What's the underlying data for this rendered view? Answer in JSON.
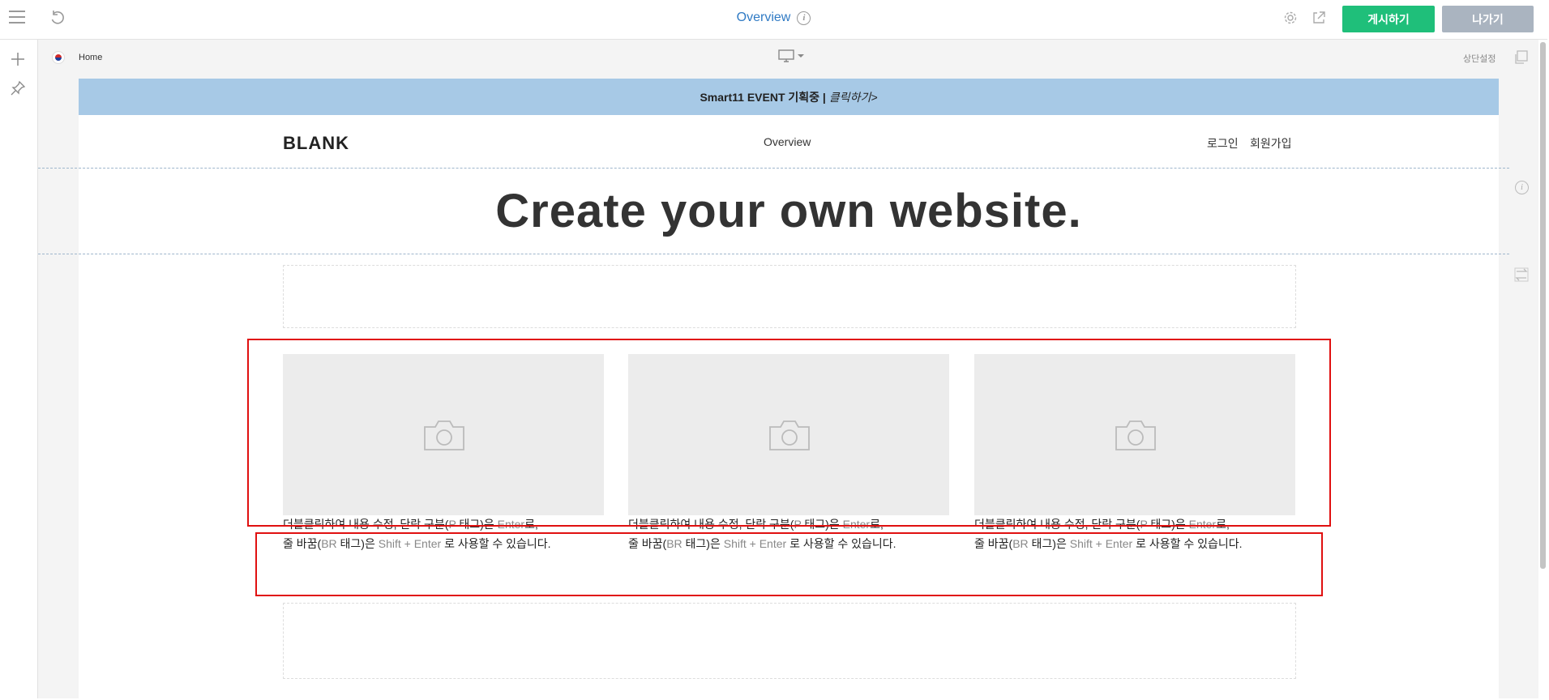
{
  "topbar": {
    "title": "Overview",
    "publish_label": "게시하기",
    "exit_label": "나가기",
    "icons": [
      "menu-icon",
      "undo-icon",
      "info-icon",
      "gear-icon",
      "external-link-icon"
    ]
  },
  "leftbar": {
    "icons": [
      "plus-icon",
      "pin-icon"
    ]
  },
  "canvas": {
    "home_label": "Home",
    "language_flag": "korea-flag-icon",
    "device": "desktop",
    "top_settings_label": "상단설정"
  },
  "page": {
    "banner": {
      "bold": "Smart11 EVENT 기획중 |",
      "italic": "클릭하기>",
      "color": "#a7c9e6"
    },
    "brand": "BLANK",
    "nav": {
      "overview": "Overview",
      "login": "로그인",
      "signup": "회원가입"
    },
    "hero_title": "Create your own website.",
    "captions": [
      {
        "line1_a": "더블클릭하여 내용 수정, 단락 구분(",
        "line1_b": "P",
        "line1_c": " 태그)은 ",
        "line1_d": "Enter",
        "line1_e": "로,",
        "line2_a": "줄 바꿈(",
        "line2_b": "BR",
        "line2_c": " 태그)은 ",
        "line2_d": "Shift + Enter",
        "line2_e": " 로 사용할 수 있습니다."
      },
      {
        "line1_a": "더블클릭하여 내용 수정, 단락 구분(",
        "line1_b": "P",
        "line1_c": " 태그)은 ",
        "line1_d": "Enter",
        "line1_e": "로,",
        "line2_a": "줄 바꿈(",
        "line2_b": "BR",
        "line2_c": " 태그)은 ",
        "line2_d": "Shift + Enter",
        "line2_e": " 로 사용할 수 있습니다."
      },
      {
        "line1_a": "더블클릭하여 내용 수정, 단락 구분(",
        "line1_b": "P",
        "line1_c": " 태그)은 ",
        "line1_d": "Enter",
        "line1_e": "로,",
        "line2_a": "줄 바꿈(",
        "line2_b": "BR",
        "line2_c": " 태그)은 ",
        "line2_d": "Shift + Enter",
        "line2_e": " 로 사용할 수 있습니다."
      }
    ]
  },
  "colors": {
    "accent": "#2f7ac4",
    "publish": "#1fbf7a",
    "exit": "#aab4c0",
    "highlight": "#e01010"
  }
}
